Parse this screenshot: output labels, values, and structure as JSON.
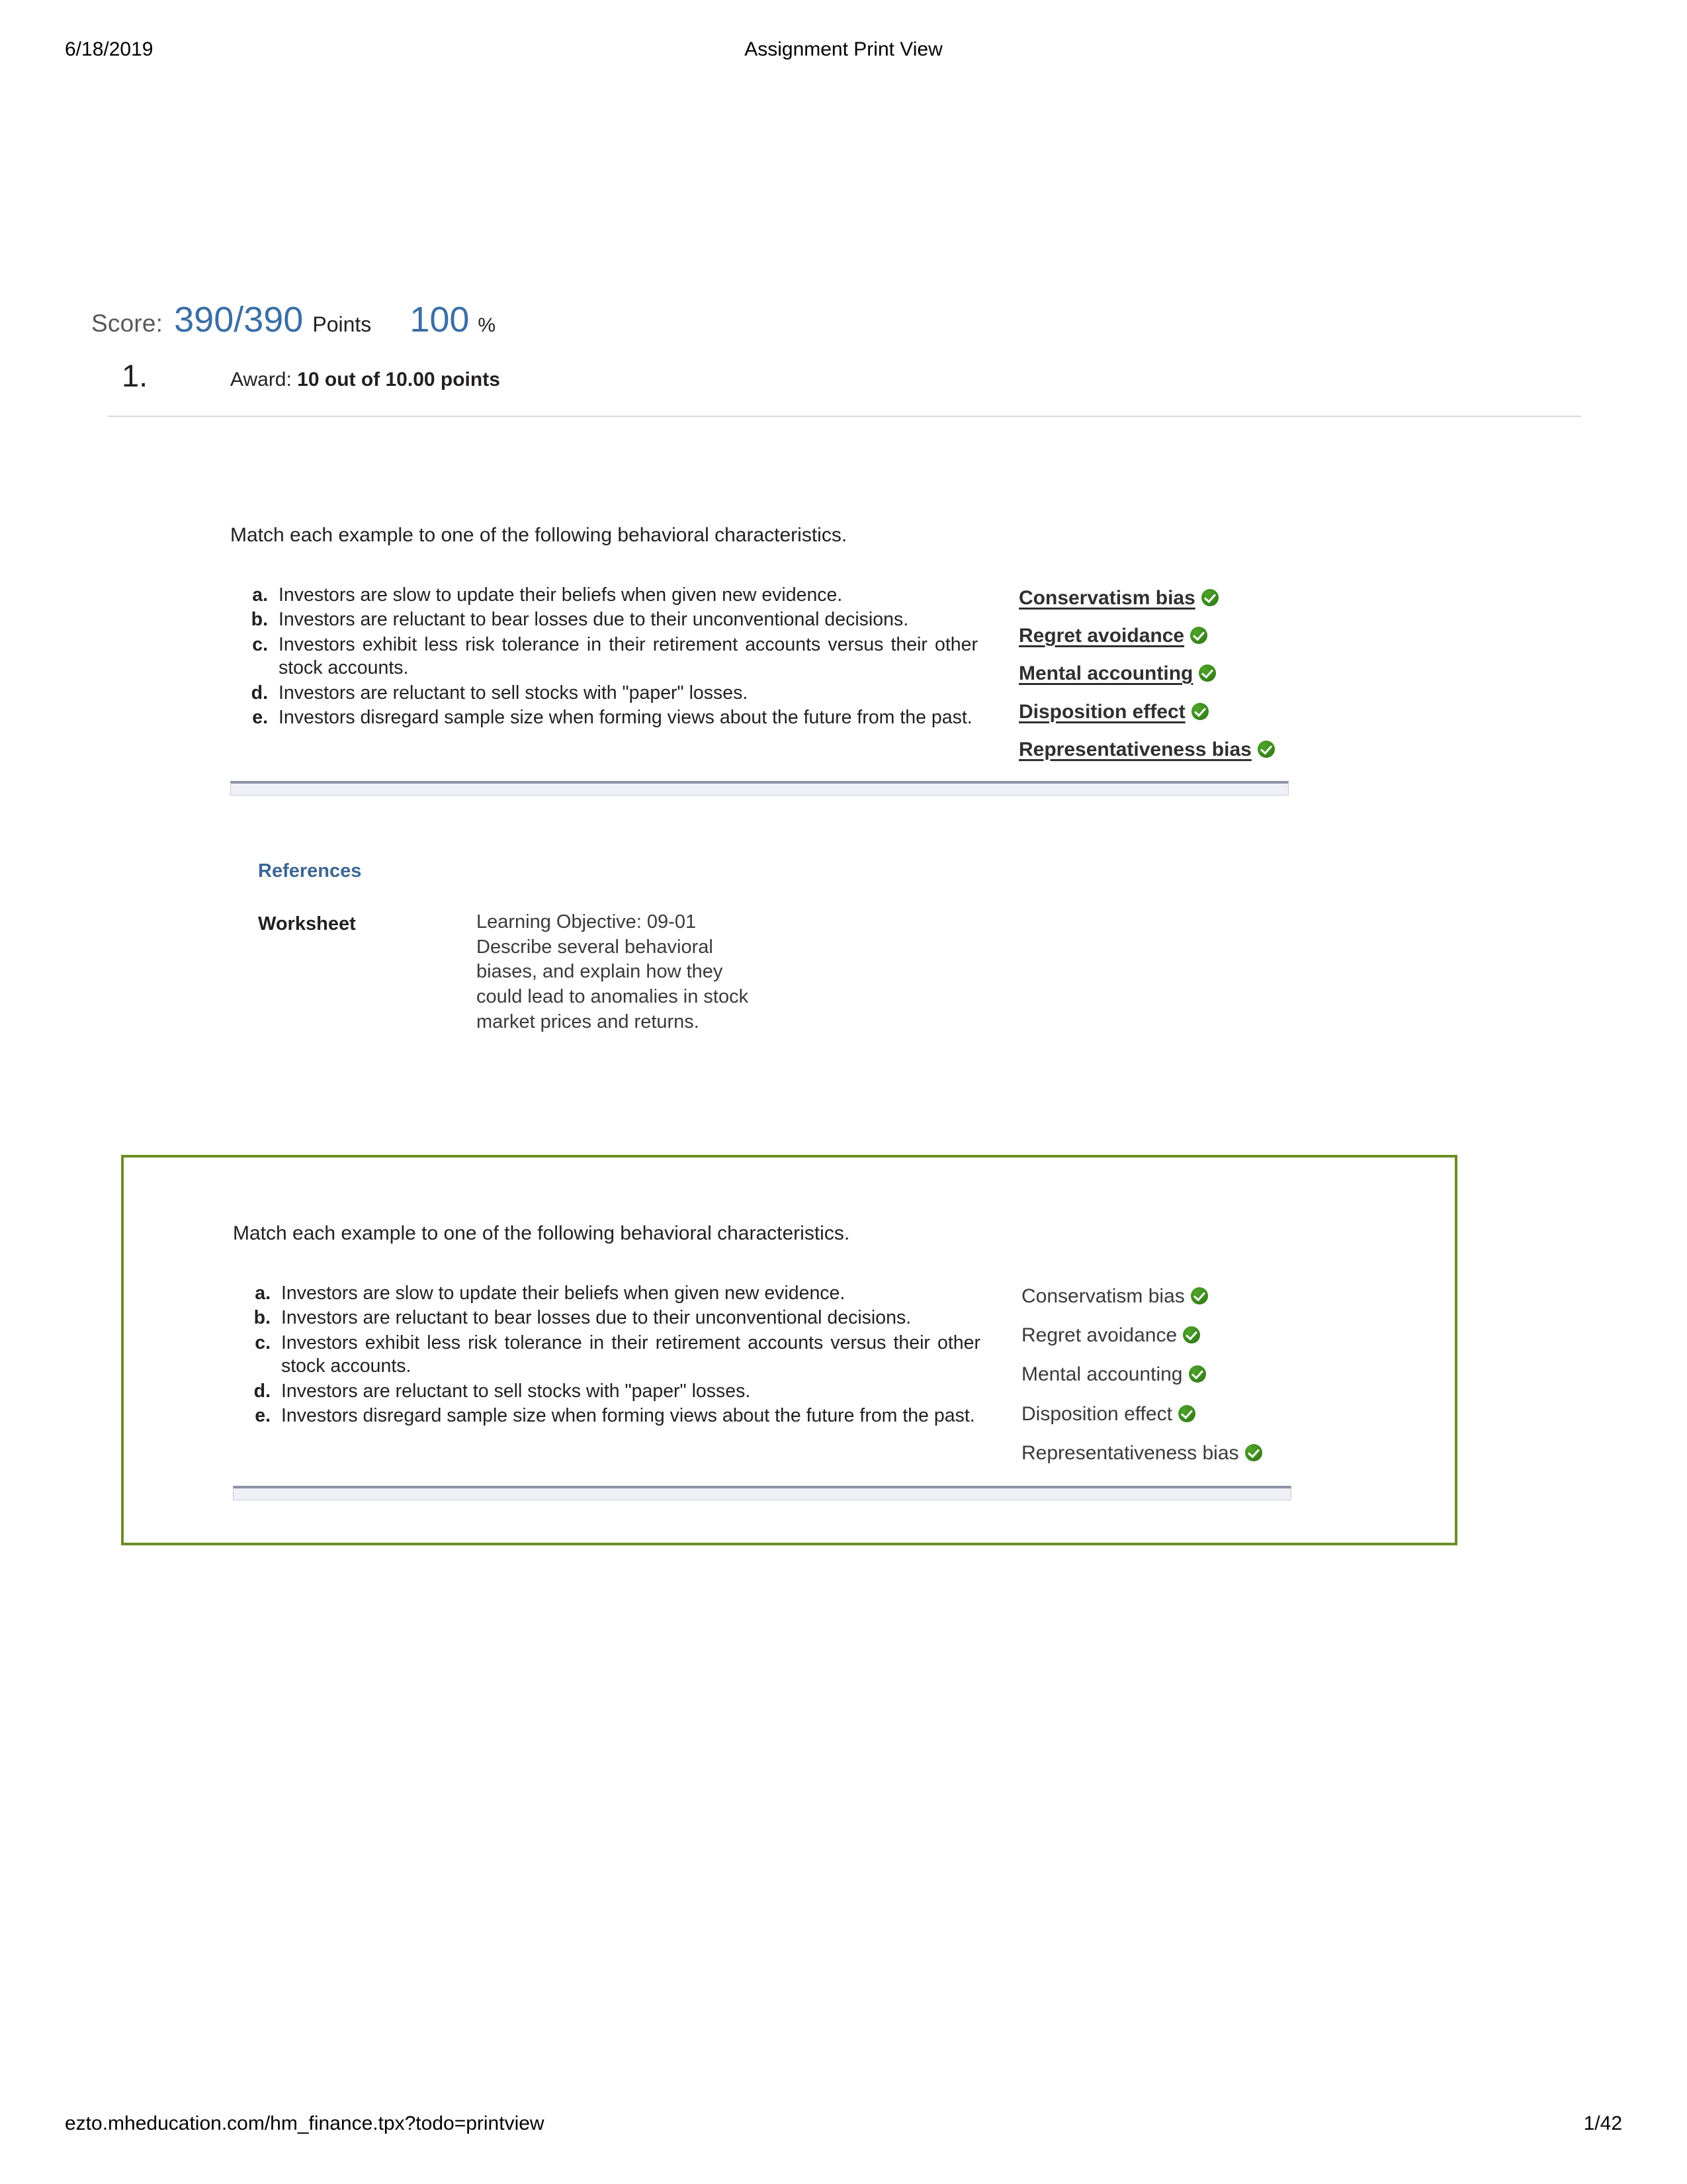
{
  "header": {
    "date": "6/18/2019",
    "title": "Assignment Print View"
  },
  "footer": {
    "url": "ezto.mheducation.com/hm_finance.tpx?todo=printview",
    "page": "1/42"
  },
  "score": {
    "label": "Score:",
    "points": "390/390",
    "points_unit": "Points",
    "percent": "100",
    "percent_unit": "%",
    "accent_color": "#3b6ea5"
  },
  "question": {
    "number": "1.",
    "award_label": "Award:",
    "award_value": "10 out of 10.00 points",
    "prompt": "Match each example to one of the following behavioral characteristics.",
    "items": [
      {
        "marker": "a.",
        "text": "Investors are slow to update their beliefs when given new evidence."
      },
      {
        "marker": "b.",
        "text": "Investors are reluctant to bear losses due to their unconventional decisions."
      },
      {
        "marker": "c.",
        "text": "Investors exhibit less risk tolerance in their retirement accounts versus their other stock accounts."
      },
      {
        "marker": "d.",
        "text": "Investors are reluctant to sell stocks with \"paper\" losses."
      },
      {
        "marker": "e.",
        "text": "Investors disregard sample size when forming views about the future from the past."
      }
    ],
    "answers": [
      {
        "label": "Conservatism bias",
        "status_icon": "green-check-icon"
      },
      {
        "label": "Regret avoidance",
        "status_icon": "green-check-icon"
      },
      {
        "label": "Mental accounting",
        "status_icon": "green-check-icon"
      },
      {
        "label": "Disposition effect",
        "status_icon": "green-check-icon"
      },
      {
        "label": "Representativeness bias",
        "status_icon": "green-check-icon"
      }
    ]
  },
  "references": {
    "title": "References",
    "row_label": "Worksheet",
    "row_value": "Learning Objective: 09-01 Describe several behavioral biases, and explain how they could lead to anomalies in stock market prices and returns."
  },
  "worksheet_box": {
    "border_color": "#6b8e23",
    "prompt": "Match each example to one of the following behavioral characteristics.",
    "items": [
      {
        "marker": "a.",
        "text": "Investors are slow to update their beliefs when given new evidence."
      },
      {
        "marker": "b.",
        "text": "Investors are reluctant to bear losses due to their unconventional decisions."
      },
      {
        "marker": "c.",
        "text": "Investors exhibit less risk tolerance in their retirement accounts versus their other stock accounts."
      },
      {
        "marker": "d.",
        "text": "Investors are reluctant to sell stocks with \"paper\" losses."
      },
      {
        "marker": "e.",
        "text": "Investors disregard sample size when forming views about the future from the past."
      }
    ],
    "answers": [
      {
        "label": "Conservatism bias",
        "status_icon": "green-check-icon"
      },
      {
        "label": "Regret avoidance",
        "status_icon": "green-check-icon"
      },
      {
        "label": "Mental accounting",
        "status_icon": "green-check-icon"
      },
      {
        "label": "Disposition effect",
        "status_icon": "green-check-icon"
      },
      {
        "label": "Representativeness bias",
        "status_icon": "green-check-icon"
      }
    ]
  }
}
